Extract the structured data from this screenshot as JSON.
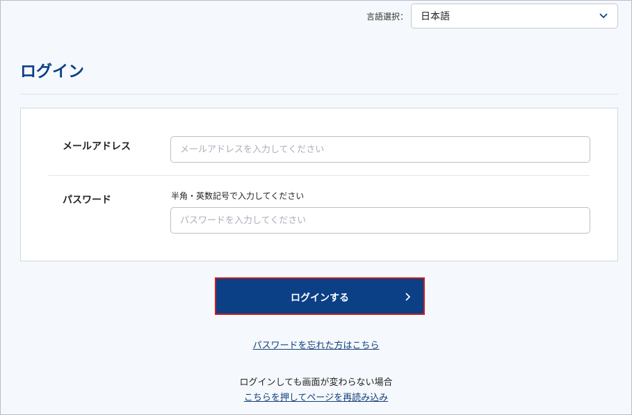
{
  "language": {
    "label": "言語選択：",
    "selected": "日本語"
  },
  "page": {
    "title": "ログイン"
  },
  "form": {
    "email": {
      "label": "メールアドレス",
      "placeholder": "メールアドレスを入力してください",
      "value": ""
    },
    "password": {
      "label": "パスワード",
      "hint": "半角・英数記号で入力してください",
      "placeholder": "パスワードを入力してください",
      "value": ""
    }
  },
  "actions": {
    "login_label": "ログインする",
    "forgot_password": "パスワードを忘れた方はこちら",
    "reload_note": "ログインしても画面が変わらない場合",
    "reload_link": "こちらを押してページを再読み込み"
  },
  "colors": {
    "brand": "#0b3f86",
    "highlight_border": "#d21c1c",
    "background": "#f5f8fc"
  },
  "icons": {
    "dropdown": "chevron-down-icon",
    "button": "chevron-right-icon"
  }
}
